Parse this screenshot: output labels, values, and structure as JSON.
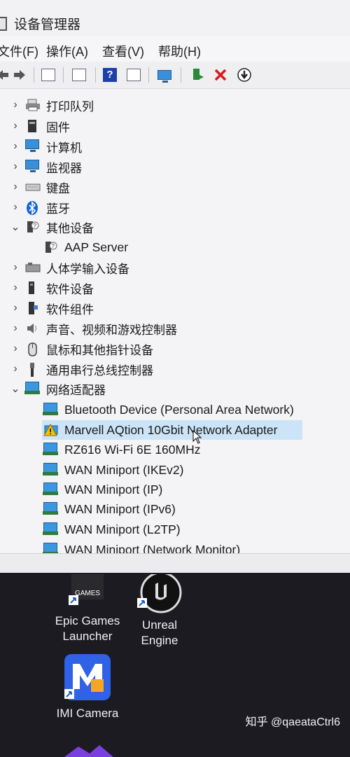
{
  "window": {
    "title": "设备管理器",
    "menu": [
      {
        "label": "文件(F)"
      },
      {
        "label": "操作(A)"
      },
      {
        "label": "查看(V)"
      },
      {
        "label": "帮助(H)"
      }
    ],
    "toolbar": {
      "icons": [
        "back-arrow-icon",
        "forward-arrow-icon",
        "properties-icon",
        "update-icon",
        "help-icon",
        "view-icon",
        "monitor-scan-icon",
        "enable-device-icon",
        "uninstall-x-icon",
        "download-driver-icon"
      ]
    }
  },
  "tree": {
    "categories": [
      {
        "label": "打印队列",
        "expanded": false
      },
      {
        "label": "固件",
        "expanded": false
      },
      {
        "label": "计算机",
        "expanded": false
      },
      {
        "label": "监视器",
        "expanded": false
      },
      {
        "label": "键盘",
        "expanded": false
      },
      {
        "label": "蓝牙",
        "expanded": false
      },
      {
        "label": "其他设备",
        "expanded": true
      },
      {
        "label": "AAP Server",
        "child": true
      },
      {
        "label": "人体学输入设备",
        "expanded": false
      },
      {
        "label": "软件设备",
        "expanded": false
      },
      {
        "label": "软件组件",
        "expanded": false
      },
      {
        "label": "声音、视频和游戏控制器",
        "expanded": false
      },
      {
        "label": "鼠标和其他指针设备",
        "expanded": false
      },
      {
        "label": "通用串行总线控制器",
        "expanded": false
      },
      {
        "label": "网络适配器",
        "expanded": true
      }
    ],
    "adapters": [
      {
        "label": "Bluetooth Device (Personal Area Network)",
        "warning": false,
        "selected": false
      },
      {
        "label": "Marvell AQtion 10Gbit Network Adapter",
        "warning": true,
        "selected": true
      },
      {
        "label": "RZ616 Wi-Fi 6E 160MHz",
        "warning": false,
        "selected": false
      },
      {
        "label": "WAN Miniport (IKEv2)",
        "warning": false,
        "selected": false
      },
      {
        "label": "WAN Miniport (IP)",
        "warning": false,
        "selected": false
      },
      {
        "label": "WAN Miniport (IPv6)",
        "warning": false,
        "selected": false
      },
      {
        "label": "WAN Miniport (L2TP)",
        "warning": false,
        "selected": false
      },
      {
        "label": "WAN Miniport (Network Monitor)",
        "warning": false,
        "selected": false
      }
    ]
  },
  "desktop": {
    "icons": [
      {
        "label_line1": "Epic Games",
        "label_line2": "Launcher",
        "logo_text": "GAMES"
      },
      {
        "label_line1": "Unreal",
        "label_line2": "Engine"
      },
      {
        "label_line1": "IMI Camera",
        "label_line2": ""
      }
    ],
    "watermark": "知乎 @qaeataCtrl6"
  },
  "colors": {
    "selection": "#cce4f7",
    "desktop_bg": "#1c1b22",
    "window_bg": "#f4f3f5"
  }
}
